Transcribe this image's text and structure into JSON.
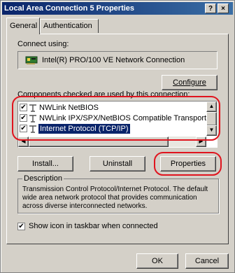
{
  "window": {
    "title": "Local Area Connection 5 Properties",
    "help_btn": "?",
    "close_btn": "×"
  },
  "tabs": [
    "General",
    "Authentication"
  ],
  "connect_using_label": "Connect using:",
  "adapter_name": "Intel(R) PRO/100 VE Network Connection",
  "configure_label": "Configure",
  "components_label": "Components checked are used by this connection:",
  "components": [
    {
      "label": "NWLink NetBIOS",
      "checked": true
    },
    {
      "label": "NWLink IPX/SPX/NetBIOS Compatible Transport Proto",
      "checked": true
    },
    {
      "label": "Internet Protocol (TCP/IP)",
      "checked": true,
      "selected": true
    }
  ],
  "buttons": {
    "install": "Install...",
    "uninstall": "Uninstall",
    "properties": "Properties"
  },
  "description": {
    "legend": "Description",
    "text": "Transmission Control Protocol/Internet Protocol. The default wide area network protocol that provides communication across diverse interconnected networks."
  },
  "show_icon": {
    "label": "Show icon in taskbar when connected",
    "checked": true
  },
  "footer": {
    "ok": "OK",
    "cancel": "Cancel"
  },
  "icons": {
    "help": "help-icon",
    "close": "close-icon",
    "adapter": "network-card-icon",
    "protocol": "network-protocol-icon"
  },
  "colors": {
    "annotation_ring": "#e0141e",
    "titlebar_start": "#0a246a",
    "titlebar_end": "#3a6ea5",
    "selection": "#0a246a"
  }
}
